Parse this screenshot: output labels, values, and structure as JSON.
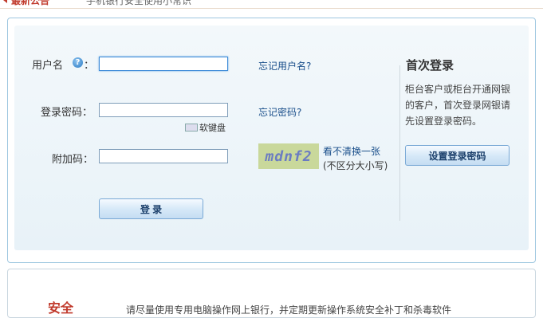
{
  "notice": {
    "label": "最新公告",
    "message": "手机银行安全使用小常识"
  },
  "login": {
    "username_label": "用户名",
    "help_glyph": "?",
    "username_colon": "：",
    "username_value": "",
    "forgot_username": "忘记用户名?",
    "password_label": "登录密码：",
    "password_value": "",
    "forgot_password": "忘记密码?",
    "soft_keyboard": "软键盘",
    "extra_code_label": "附加码：",
    "extra_code_value": "",
    "captcha_text": "mdnf2",
    "refresh_captcha": "看不清换一张",
    "case_insensitive": "(不区分大小写)",
    "login_button": "登 录"
  },
  "first_login": {
    "title": "首次登录",
    "description_line1": "柜台客户或柜台开通网银",
    "description_line2": "的客户，首次登录网银请",
    "description_line3": "先设置登录密码。",
    "button": "设置登录密码"
  },
  "security": {
    "title": "安全",
    "text": "请尽量使用专用电脑操作网上银行，并定期更新操作系统安全补丁和杀毒软件"
  },
  "colors": {
    "accent_red": "#c0392b",
    "link_blue": "#1a4f8b",
    "panel_border": "#9ec7e0"
  }
}
